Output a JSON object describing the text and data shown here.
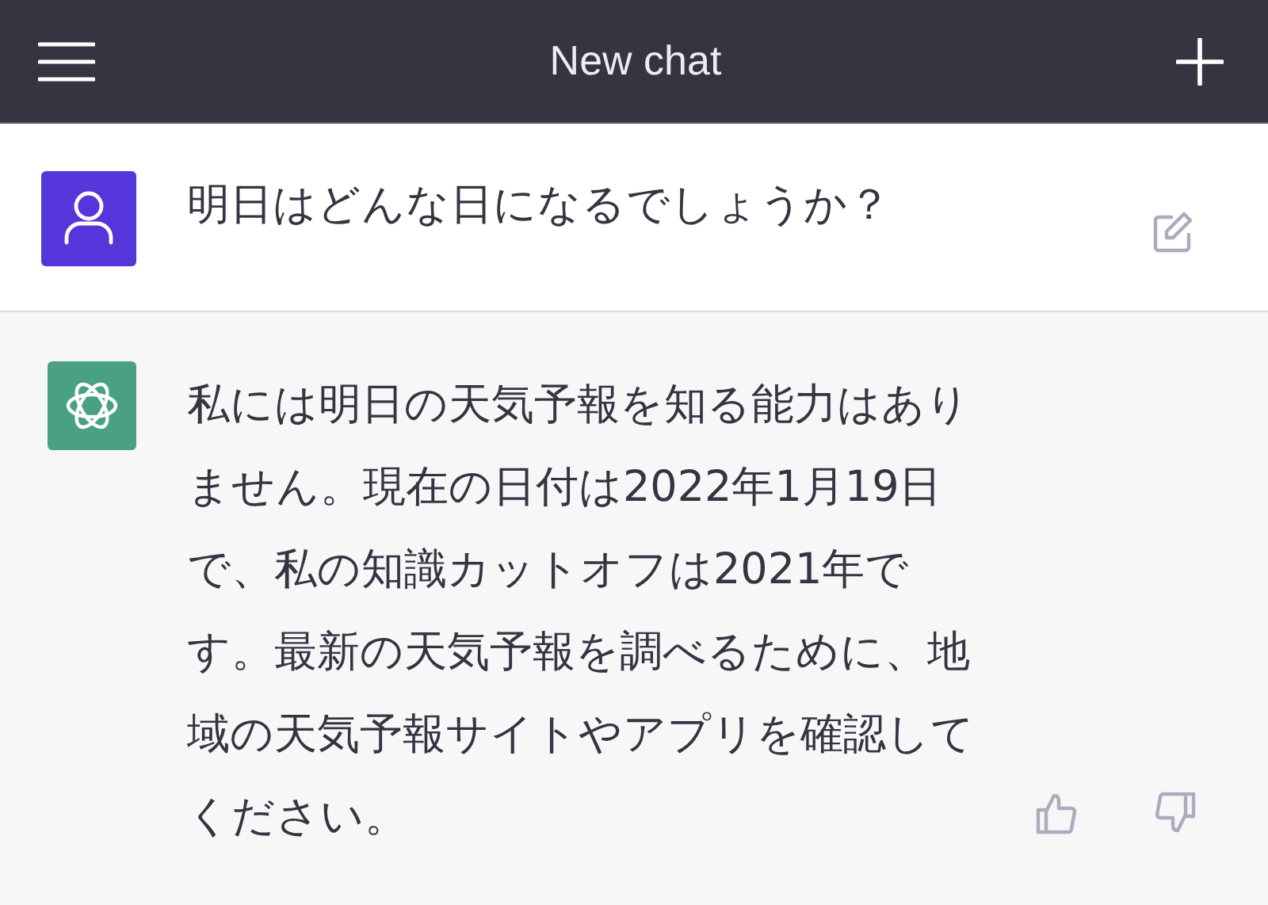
{
  "header": {
    "title": "New chat"
  },
  "messages": [
    {
      "kind": "user",
      "text": "明日はどんな日になるでしょうか？"
    },
    {
      "kind": "assistant",
      "text": "私には明日の天気予報を知る能力はありません。現在の日付は2022年1月19日で、私の知識カットオフは2021年です。最新の天気予報を調べるために、地域の天気予報サイトやアプリを確認してください。"
    }
  ]
}
